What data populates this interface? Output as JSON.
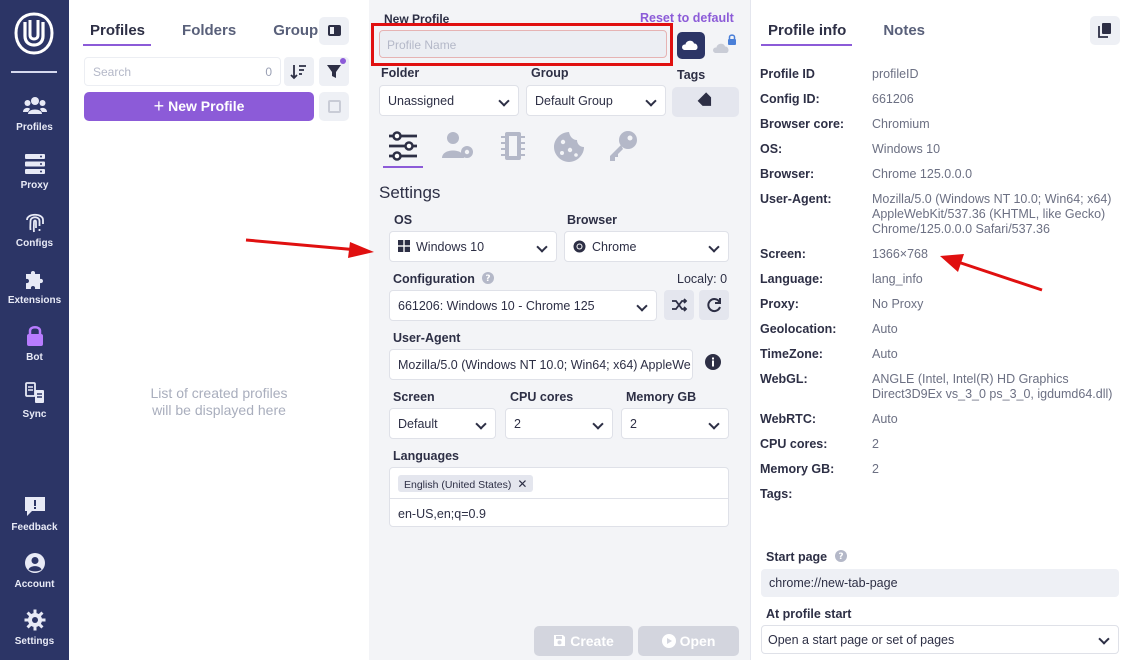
{
  "nav": {
    "items": [
      {
        "label": "Profiles",
        "icon": "users-icon"
      },
      {
        "label": "Proxy",
        "icon": "server-icon"
      },
      {
        "label": "Configs",
        "icon": "fingerprint-icon"
      },
      {
        "label": "Extensions",
        "icon": "puzzle-icon"
      },
      {
        "label": "Bot",
        "icon": "lock-icon"
      },
      {
        "label": "Sync",
        "icon": "sync-icon"
      },
      {
        "label": "Feedback",
        "icon": "feedback-icon"
      },
      {
        "label": "Account",
        "icon": "account-icon"
      },
      {
        "label": "Settings",
        "icon": "gear-icon"
      }
    ],
    "bg_color": "#2c3566",
    "accent_color": "#8c5bd8"
  },
  "profiles": {
    "tabs": [
      "Profiles",
      "Folders",
      "Groups"
    ],
    "search_placeholder": "Search",
    "count": "0",
    "new_profile_label": "New Profile",
    "empty_line1": "List of created profiles",
    "empty_line2": "will be displayed here"
  },
  "new_profile": {
    "title": "New Profile",
    "reset_label": "Reset to default",
    "name_placeholder": "Profile Name",
    "folder_label": "Folder",
    "folder_value": "Unassigned",
    "group_label": "Group",
    "group_value": "Default Group",
    "tags_label": "Tags",
    "settings_title": "Settings",
    "os_label": "OS",
    "os_value": "Windows 10",
    "browser_label": "Browser",
    "browser_value": "Chrome",
    "configuration_label": "Configuration",
    "locally_label": "Localy: 0",
    "configuration_value": "661206: Windows 10 - Chrome 125",
    "user_agent_label": "User-Agent",
    "user_agent_value": "Mozilla/5.0 (Windows NT 10.0; Win64; x64) AppleWe",
    "screen_label": "Screen",
    "screen_value": "Default",
    "cpu_label": "CPU cores",
    "cpu_value": "2",
    "memory_label": "Memory GB",
    "memory_value": "2",
    "languages_label": "Languages",
    "language_chip": "English (United States)",
    "accept_language": "en-US,en;q=0.9",
    "create_label": "Create",
    "open_label": "Open"
  },
  "profile_info": {
    "tabs": [
      "Profile info",
      "Notes"
    ],
    "rows": [
      {
        "key": "Profile ID",
        "value": "profileID"
      },
      {
        "key": "Config ID:",
        "value": "661206"
      },
      {
        "key": "Browser core:",
        "value": "Chromium"
      },
      {
        "key": "OS:",
        "value": "Windows 10"
      },
      {
        "key": "Browser:",
        "value": "Chrome 125.0.0.0"
      },
      {
        "key": "User-Agent:",
        "value": "Mozilla/5.0 (Windows NT 10.0; Win64; x64) AppleWebKit/537.36 (KHTML, like Gecko) Chrome/125.0.0.0 Safari/537.36"
      },
      {
        "key": "Screen:",
        "value": "1366×768"
      },
      {
        "key": "Language:",
        "value": "lang_info"
      },
      {
        "key": "Proxy:",
        "value": "No Proxy"
      },
      {
        "key": "Geolocation:",
        "value": "Auto"
      },
      {
        "key": "TimeZone:",
        "value": "Auto"
      },
      {
        "key": "WebGL:",
        "value": "ANGLE (Intel, Intel(R) HD Graphics Direct3D9Ex vs_3_0 ps_3_0, igdumd64.dll)"
      },
      {
        "key": "WebRTC:",
        "value": "Auto"
      },
      {
        "key": "CPU cores:",
        "value": "2"
      },
      {
        "key": "Memory GB:",
        "value": "2"
      },
      {
        "key": "Tags:",
        "value": ""
      }
    ],
    "start_page_label": "Start page",
    "start_page_value": "chrome://new-tab-page",
    "at_start_label": "At profile start",
    "at_start_value": "Open a start page or set of pages"
  }
}
